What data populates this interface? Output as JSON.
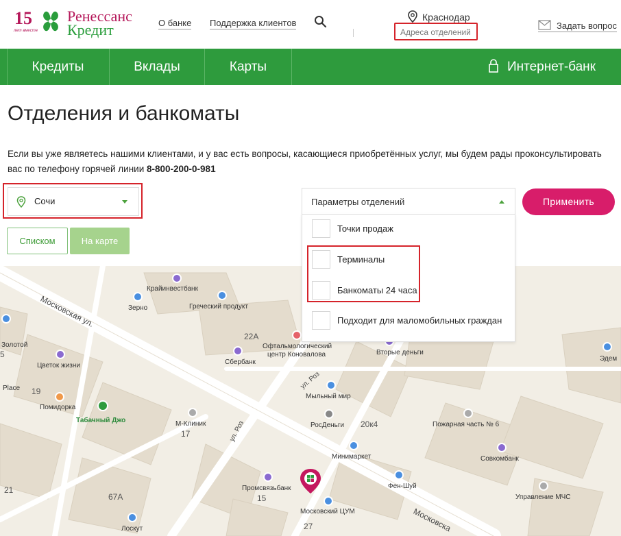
{
  "header": {
    "logo_number": "15",
    "logo_sub": "лет вместе",
    "logo_line1": "Ренессанс",
    "logo_line2": "Кредит",
    "links": [
      "О банке",
      "Поддержка клиентов"
    ],
    "city": "Краснодар",
    "addresses_link": "Адреса отделений",
    "ask_question": "Задать вопрос"
  },
  "nav": {
    "items": [
      "Кредиты",
      "Вклады",
      "Карты"
    ],
    "internet_bank": "Интернет-банк"
  },
  "page": {
    "title": "Отделения и банкоматы",
    "intro_text": "Если вы уже являетесь нашими клиентами, и у вас есть вопросы, касающиеся приобретённых услуг, мы будем рады проконсультировать вас по телефону горячей линии ",
    "hotline": "8-800-200-0-981"
  },
  "filters": {
    "city_value": "Сочи",
    "list_button": "Списком",
    "map_button": "На карте",
    "params_label": "Параметры отделений",
    "apply_button": "Применить",
    "options": [
      {
        "label": "Точки продаж",
        "checked": false
      },
      {
        "label": "Терминалы",
        "checked": false
      },
      {
        "label": "Банкоматы 24 часа",
        "checked": false
      },
      {
        "label": "Подходит для маломобильных граждан",
        "checked": false
      }
    ]
  },
  "map": {
    "streets": [
      "Московская ул.",
      "ул. Роз",
      "ул. Роз",
      "Московска"
    ],
    "house_numbers": [
      "22А",
      "5",
      "19",
      "17",
      "20к4",
      "21",
      "67А",
      "15",
      "27"
    ],
    "pois": [
      "Крайинвестбанк",
      "Греческий продукт",
      "Зерно",
      "Золотой",
      "Цветок жизни",
      "Офтальмологический",
      "центр Коновалова",
      "Сбербанк",
      "Вторые деньги",
      "Place",
      "Помидорка",
      "Табачный Джо",
      "М-Клиник",
      "Мыльный мир",
      "РосДеньги",
      "Пожарная часть № 6",
      "Минимаркет",
      "Совкомбанк",
      "Промсвязьбанк",
      "Фен-Шуй",
      "Управление МЧС",
      "Московский ЦУМ",
      "Лоскут",
      "Эдем"
    ]
  },
  "colors": {
    "brand_green": "#2e9b3d",
    "brand_magenta": "#d81d6a",
    "highlight_red": "#d5232a"
  }
}
